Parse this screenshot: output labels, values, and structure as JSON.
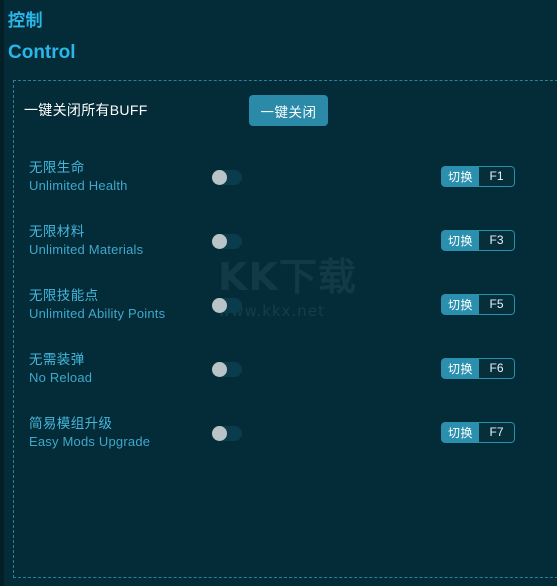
{
  "header": {
    "title_cn": "控制",
    "title_en": "Control"
  },
  "master": {
    "label": "一键关闭所有BUFF",
    "button_label": "一键关闭"
  },
  "watermark": {
    "main": "KK下载",
    "sub": "www.kkx.net"
  },
  "colors": {
    "background": "#032b38",
    "accent": "#2ab6e8",
    "button": "#2b8aa8",
    "hotkey_action": "#2b90ae",
    "border_dashed": "#2f7f95",
    "toggle_track": "#0b3c4d",
    "toggle_knob": "#b9c4c7"
  },
  "rows": [
    {
      "label_cn": "无限生命",
      "label_en": "Unlimited Health",
      "toggle_state": "off",
      "hotkey_action": "切换",
      "hotkey_key": "F1"
    },
    {
      "label_cn": "无限材料",
      "label_en": "Unlimited Materials",
      "toggle_state": "off",
      "hotkey_action": "切换",
      "hotkey_key": "F3"
    },
    {
      "label_cn": "无限技能点",
      "label_en": "Unlimited Ability Points",
      "toggle_state": "off",
      "hotkey_action": "切换",
      "hotkey_key": "F5"
    },
    {
      "label_cn": "无需装弹",
      "label_en": "No Reload",
      "toggle_state": "off",
      "hotkey_action": "切换",
      "hotkey_key": "F6"
    },
    {
      "label_cn": "简易模组升级",
      "label_en": "Easy Mods Upgrade",
      "toggle_state": "off",
      "hotkey_action": "切换",
      "hotkey_key": "F7"
    }
  ]
}
